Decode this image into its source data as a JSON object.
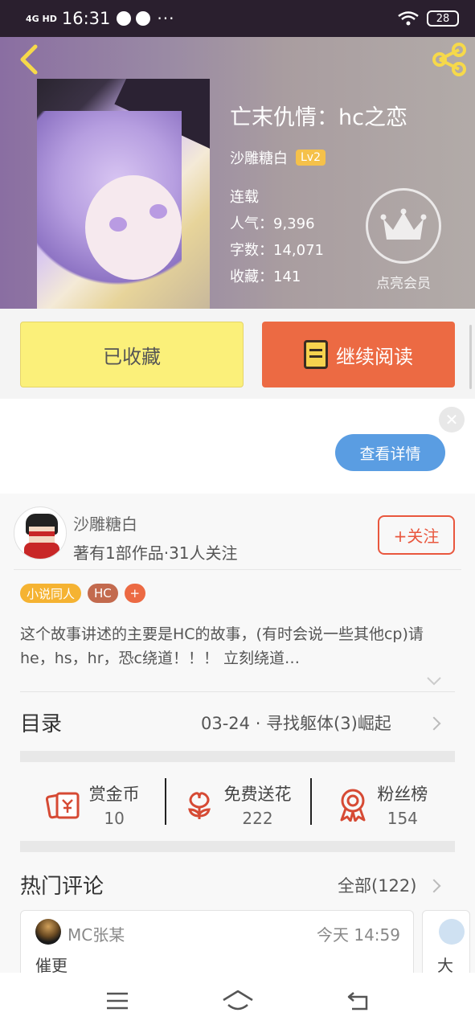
{
  "status_bar": {
    "network": "4G HD",
    "time": "16:31",
    "more": "···",
    "battery": "28"
  },
  "book": {
    "title": "亡末仇情：hc之恋",
    "author": "沙雕糖白",
    "level": "Lv2",
    "status": "连载",
    "popularity_label": "人气：",
    "popularity": "9,396",
    "wordcount_label": "字数：",
    "wordcount": "14,071",
    "favorites_label": "收藏：",
    "favorites": "141",
    "vip_label": "点亮会员"
  },
  "actions": {
    "favorited_label": "已收藏",
    "continue_label": "继续阅读"
  },
  "ad": {
    "close_symbol": "✕",
    "detail_label": "查看详情"
  },
  "author": {
    "name": "沙雕糖白",
    "meta": "著有1部作品·31人关注",
    "follow_label": "+关注"
  },
  "tags": [
    "小说同人",
    "HC",
    "+"
  ],
  "description": "这个故事讲述的主要是HC的故事，(有时会说一些其他cp)请he，hs，hr，恐c绕道！！！ 立刻绕道…",
  "toc": {
    "label": "目录",
    "latest": "03-24 · 寻找躯体(3)崛起"
  },
  "stats": [
    {
      "icon": "envelope-coin-icon",
      "label": "赏金币",
      "value": "10"
    },
    {
      "icon": "flower-icon",
      "label": "免费送花",
      "value": "222"
    },
    {
      "icon": "medal-icon",
      "label": "粉丝榜",
      "value": "154"
    }
  ],
  "comments_section": {
    "label": "热门评论",
    "all_label": "全部(122)"
  },
  "comments": [
    {
      "user": "MC张某",
      "time": "今天 14:59",
      "text": "催更"
    },
    {
      "user": "",
      "time": "",
      "text": "大"
    }
  ],
  "colors": {
    "accent_orange": "#ec6a43",
    "favorite_yellow": "#fbf07a",
    "level_badge": "#f5c14a",
    "detail_blue": "#5a9de2",
    "icon_red": "#d64a34"
  }
}
